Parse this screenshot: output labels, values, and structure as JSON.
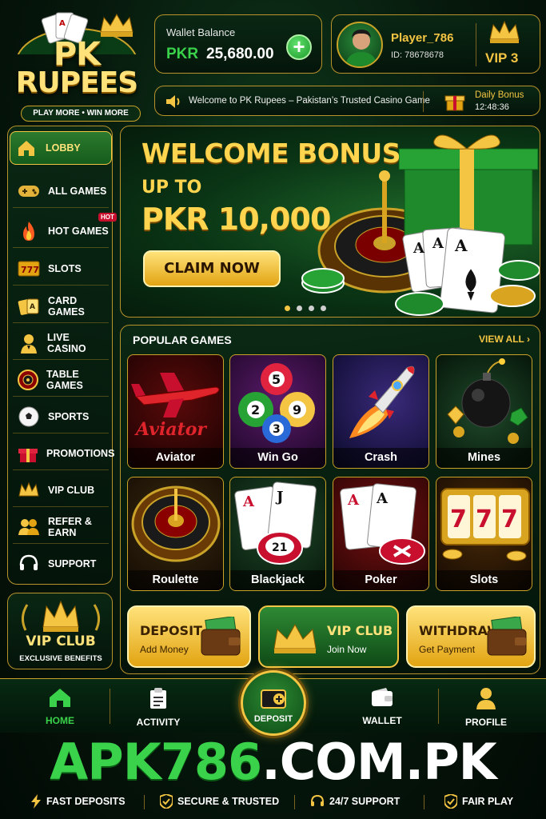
{
  "brand": {
    "line1": "PK",
    "line2": "RUPEES",
    "tagline": "PLAY MORE • WIN MORE"
  },
  "wallet": {
    "label": "Wallet Balance",
    "currency": "PKR",
    "amount": "25,680.00"
  },
  "player": {
    "name": "Player_786",
    "id": "ID: 78678678",
    "vip": "VIP 3"
  },
  "ticker": {
    "message": "Welcome to PK Rupees – Pakistan’s Trusted Casino Game",
    "daily_bonus_label": "Daily Bonus",
    "daily_bonus_timer": "12:48:36"
  },
  "sidebar": {
    "items": [
      {
        "label": "LOBBY",
        "icon": "home-icon"
      },
      {
        "label": "ALL GAMES",
        "icon": "gamepad-icon"
      },
      {
        "label": "HOT GAMES",
        "icon": "flame-icon",
        "badge": "HOT"
      },
      {
        "label": "SLOTS",
        "icon": "slots-icon"
      },
      {
        "label": "CARD GAMES",
        "icon": "cards-icon"
      },
      {
        "label": "LIVE CASINO",
        "icon": "dealer-icon"
      },
      {
        "label": "TABLE GAMES",
        "icon": "roulette-icon"
      },
      {
        "label": "SPORTS",
        "icon": "soccer-ball-icon"
      },
      {
        "label": "PROMOTIONS",
        "icon": "gift-icon"
      },
      {
        "label": "VIP CLUB",
        "icon": "crown-icon"
      },
      {
        "label": "REFER & EARN",
        "icon": "users-icon"
      },
      {
        "label": "SUPPORT",
        "icon": "headset-icon"
      }
    ],
    "vip_card": {
      "title": "VIP CLUB",
      "subtitle": "EXCLUSIVE BENEFITS"
    }
  },
  "banner": {
    "headline": "WELCOME BONUS",
    "up_to": "UP TO",
    "amount": "PKR 10,000",
    "cta": "CLAIM NOW",
    "slide_count": 4,
    "active_slide": 1
  },
  "popular": {
    "title": "POPULAR GAMES",
    "view_all": "VIEW ALL",
    "games": [
      {
        "name": "Aviator",
        "logo_text": "Aviator"
      },
      {
        "name": "Win Go"
      },
      {
        "name": "Crash"
      },
      {
        "name": "Mines"
      },
      {
        "name": "Roulette"
      },
      {
        "name": "Blackjack"
      },
      {
        "name": "Poker"
      },
      {
        "name": "Slots"
      }
    ]
  },
  "quick_actions": [
    {
      "title": "DEPOSIT",
      "subtitle": "Add Money"
    },
    {
      "title": "VIP CLUB",
      "subtitle": "Join Now"
    },
    {
      "title": "WITHDRAW",
      "subtitle": "Get Payment"
    }
  ],
  "bottom_nav": {
    "items": [
      {
        "label": "HOME",
        "icon": "home-icon"
      },
      {
        "label": "ACTIVITY",
        "icon": "clipboard-icon"
      },
      {
        "label": "DEPOSIT",
        "icon": "wallet-plus-icon"
      },
      {
        "label": "WALLET",
        "icon": "wallet-icon"
      },
      {
        "label": "PROFILE",
        "icon": "user-icon"
      }
    ]
  },
  "domain": {
    "green": "APK786",
    "white": ".COM.PK"
  },
  "features": [
    {
      "label": "FAST DEPOSITS",
      "icon": "lightning-icon"
    },
    {
      "label": "SECURE & TRUSTED",
      "icon": "shield-check-icon"
    },
    {
      "label": "24/7 SUPPORT",
      "icon": "headset-icon"
    },
    {
      "label": "FAIR PLAY",
      "icon": "shield-check-icon"
    }
  ],
  "colors": {
    "gold": "#f4c542",
    "green": "#3ad24a",
    "background": "#06180c",
    "hot": "#c8102e"
  }
}
